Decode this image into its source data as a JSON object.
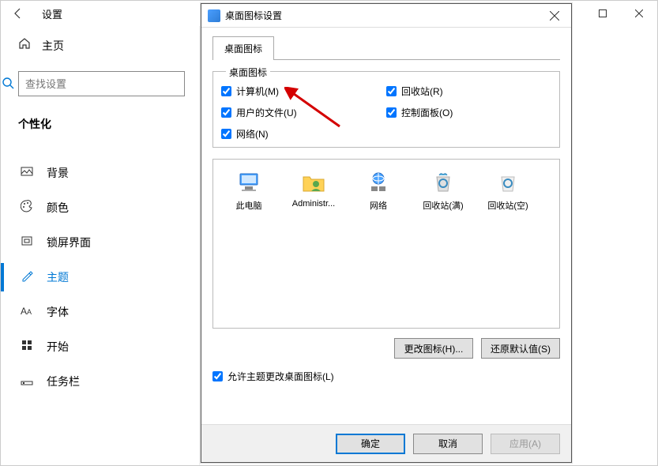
{
  "settings": {
    "title": "设置",
    "home_label": "主页",
    "search_placeholder": "查找设置",
    "category": "个性化",
    "nav": [
      {
        "icon": "background",
        "label": "背景"
      },
      {
        "icon": "colors",
        "label": "颜色"
      },
      {
        "icon": "lockscreen",
        "label": "锁屏界面"
      },
      {
        "icon": "themes",
        "label": "主题",
        "selected": true
      },
      {
        "icon": "fonts",
        "label": "字体"
      },
      {
        "icon": "start",
        "label": "开始"
      },
      {
        "icon": "taskbar",
        "label": "任务栏"
      }
    ]
  },
  "dialog": {
    "title": "桌面图标设置",
    "tab_label": "桌面图标",
    "fieldset_legend": "桌面图标",
    "checkboxes": {
      "computer": {
        "label": "计算机(M)",
        "checked": true
      },
      "userfiles": {
        "label": "用户的文件(U)",
        "checked": true
      },
      "network": {
        "label": "网络(N)",
        "checked": true
      },
      "recycle": {
        "label": "回收站(R)",
        "checked": true
      },
      "control": {
        "label": "控制面板(O)",
        "checked": true
      }
    },
    "grid": [
      {
        "id": "this-pc",
        "label": "此电脑"
      },
      {
        "id": "administrator",
        "label": "Administr..."
      },
      {
        "id": "network",
        "label": "网络"
      },
      {
        "id": "recycle-full",
        "label": "回收站(满)"
      },
      {
        "id": "recycle-empty",
        "label": "回收站(空)"
      }
    ],
    "change_icon_label": "更改图标(H)...",
    "restore_default_label": "还原默认值(S)",
    "allow_themes_label": "允许主题更改桌面图标(L)",
    "allow_themes_checked": true,
    "footer": {
      "ok": "确定",
      "cancel": "取消",
      "apply": "应用(A)"
    }
  }
}
